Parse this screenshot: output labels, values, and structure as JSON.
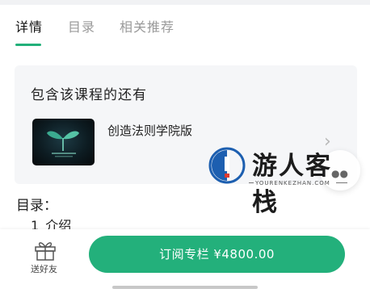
{
  "tabs": [
    {
      "label": "详情",
      "active": true
    },
    {
      "label": "目录",
      "active": false
    },
    {
      "label": "相关推荐",
      "active": false
    }
  ],
  "course_card": {
    "heading": "包含该课程的还有",
    "item": {
      "title": "创造法则学院版",
      "thumbnail_icon": "sprout-logo-icon"
    }
  },
  "watermark": {
    "text": "游人客栈",
    "subtext": "YOURENKEZHAN.COM"
  },
  "toc": {
    "title": "目录：",
    "items": [
      {
        "num": "1",
        "label": "介绍"
      }
    ]
  },
  "bottom_bar": {
    "gift_label": "送好友",
    "subscribe_label": "订阅专栏 ¥4800.00"
  },
  "colors": {
    "accent": "#23b07b",
    "card_bg": "#f5f6f8"
  }
}
